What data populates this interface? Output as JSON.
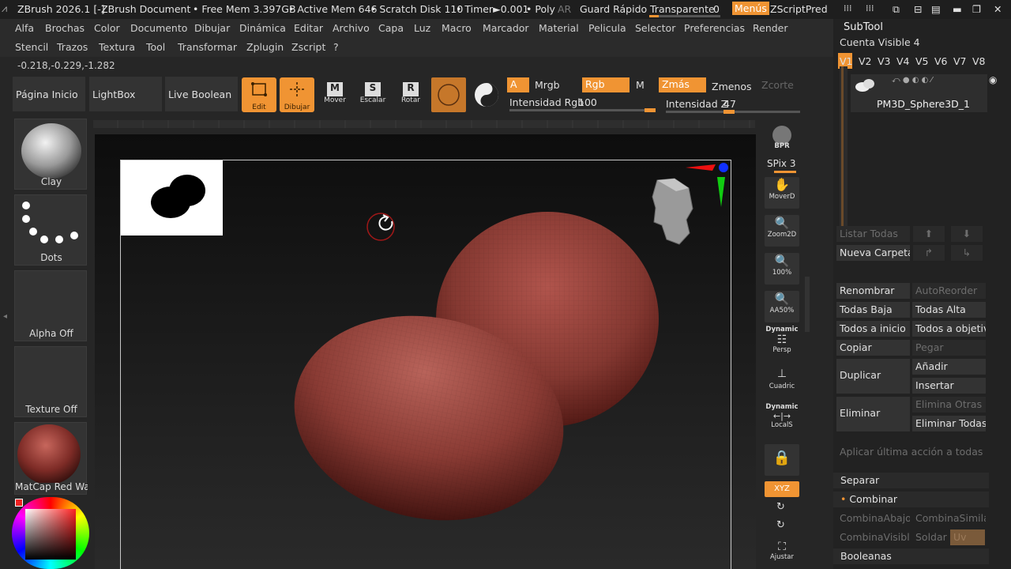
{
  "title_bar": {
    "app": "ZBrush 2026.1 [-]",
    "document": "ZBrush Document",
    "free_mem": "• Free Mem 3.397GB",
    "active_mem": "• Active Mem 646",
    "scratch": "• Scratch Disk 110",
    "timer": "• Timer►0.001",
    "poly": "• Poly",
    "ar": "AR",
    "quick_save": "Guard Rápido",
    "transparent": "Transparente",
    "transparent_value": "0",
    "menus": "Menús",
    "zscript": "ZScriptPred"
  },
  "menu_row1": [
    "Alfa",
    "Brochas",
    "Color",
    "Documento",
    "Dibujar",
    "Dinámica",
    "Editar",
    "Archivo",
    "Capa",
    "Luz",
    "Macro",
    "Marcador",
    "Material",
    "Pelicula",
    "Selector",
    "Preferencias",
    "Render"
  ],
  "menu_row2": [
    "Stencil",
    "Trazos",
    "Textura",
    "Tool",
    "Transformar",
    "Zplugin",
    "Zscript",
    "?"
  ],
  "coordinates": "-0.218,-0.229,-1.282",
  "toolbar": {
    "home": "Página Inicio",
    "lightbox": "LightBox",
    "live_boolean": "Live Boolean",
    "edit": "Edit",
    "draw": "Dibujar",
    "move": "Mover",
    "scale": "Escalar",
    "rotate": "Rotar",
    "a": "A",
    "mrgb": "Mrgb",
    "rgb": "Rgb",
    "m": "M",
    "zadd": "Zmás",
    "zsub": "Zmenos",
    "zcut": "Zcorte",
    "rgb_intensity_label": "Intensidad Rgb",
    "rgb_intensity": "100",
    "z_intensity_label": "Intensidad Z",
    "z_intensity": "47",
    "rgb_intensity_fraction": 1.0,
    "z_intensity_fraction": 0.47
  },
  "left_panel": {
    "brush": "Clay",
    "stroke": "Dots",
    "alpha": "Alpha Off",
    "texture": "Texture Off",
    "material": "MatCap Red Wax"
  },
  "right_shelf": {
    "bpr": "BPR",
    "spix_label": "SPix",
    "spix": "3",
    "move": "MoverD",
    "zoom": "Zoom2D",
    "actual": "100%",
    "aahalf": "AA50%",
    "dynamic": "Dynamic",
    "persp": "Persp",
    "floor": "Cuadric",
    "dynamic2": "Dynamic",
    "local": "LocalS",
    "xyz": "XYZ",
    "frame": "Ajustar"
  },
  "subtool": {
    "header": "SubTool",
    "visible_count_label": "Cuenta Visible",
    "visible_count": "4",
    "versions": [
      "V1",
      "V2",
      "V3",
      "V4",
      "V5",
      "V6",
      "V7",
      "V8"
    ],
    "item_name": "PM3D_Sphere3D_1",
    "list_all": "Listar Todas",
    "new_folder": "Nueva Carpeta",
    "rename": "Renombrar",
    "autoreorder": "AutoReorder",
    "all_low": "Todas Baja",
    "all_high": "Todas Alta",
    "all_to_start": "Todos a inicio",
    "all_to_target": "Todos a objetivo",
    "copy": "Copiar",
    "paste": "Pegar",
    "duplicate": "Duplicar",
    "append": "Añadir",
    "insert": "Insertar",
    "delete": "Eliminar",
    "delete_others": "Elimina Otras",
    "delete_all": "Eliminar Todas",
    "apply_last": "Aplicar última acción a todas las h",
    "split": "Separar",
    "merge": "Combinar",
    "merge_down": "CombinaAbajo",
    "merge_similar": "CombinaSimilar",
    "merge_visible": "CombinaVisible",
    "weld": "Soldar",
    "uv": "Uv",
    "booleans": "Booleanas"
  },
  "colors": {
    "accent": "#f09433",
    "bg": "#262626",
    "panel": "#333333",
    "wax": "#8a3a35"
  }
}
